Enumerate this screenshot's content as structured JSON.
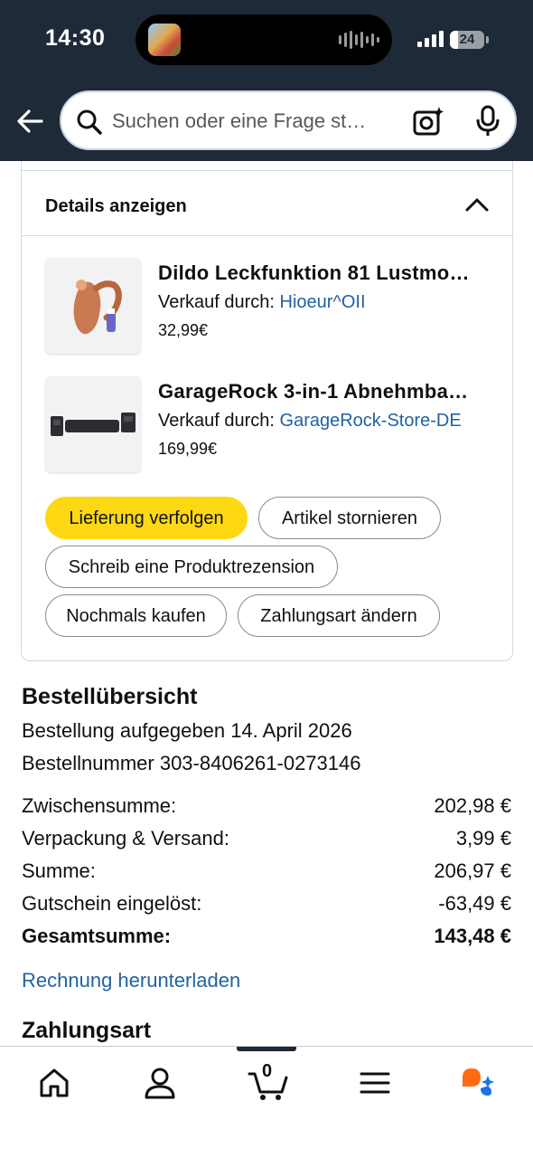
{
  "status_bar": {
    "time": "14:30",
    "battery": "24"
  },
  "search": {
    "placeholder": "Suchen oder eine Frage st…"
  },
  "details": {
    "label": "Details anzeigen"
  },
  "items": [
    {
      "title": "Dildo Leckfunktion 81 Lustmo…",
      "seller_prefix": "Verkauf durch: ",
      "seller": "Hioeur^OII",
      "price": "32,99€"
    },
    {
      "title": "GarageRock 3-in-1 Abnehmba…",
      "seller_prefix": "Verkauf durch: ",
      "seller": "GarageRock-Store-DE",
      "price": "169,99€"
    }
  ],
  "actions": {
    "track": "Lieferung verfolgen",
    "cancel": "Artikel stornieren",
    "review": "Schreib eine Produktrezension",
    "buy_again": "Nochmals kaufen",
    "change_payment": "Zahlungsart ändern"
  },
  "summary": {
    "title": "Bestellübersicht",
    "placed": "Bestellung aufgegeben 14. April 2026",
    "order_number": "Bestellnummer 303-8406261-0273146",
    "rows": [
      {
        "label": "Zwischensumme:",
        "value": "202,98 €"
      },
      {
        "label": "Verpackung & Versand:",
        "value": "3,99 €"
      },
      {
        "label": "Summe:",
        "value": "206,97 €"
      },
      {
        "label": "Gutschein eingelöst:",
        "value": "-63,49 €"
      },
      {
        "label": "Gesamtsumme:",
        "value": "143,48 €"
      }
    ],
    "invoice_link": "Rechnung herunterladen",
    "payment_title": "Zahlungsart"
  },
  "bottom_nav": {
    "cart_count": "0",
    "icons": [
      "home-icon",
      "account-icon",
      "cart-icon",
      "menu-icon",
      "rufus-icon"
    ]
  },
  "colors": {
    "header": "#1f2a38",
    "primary_button": "#ffd814",
    "link": "#2162a1"
  }
}
